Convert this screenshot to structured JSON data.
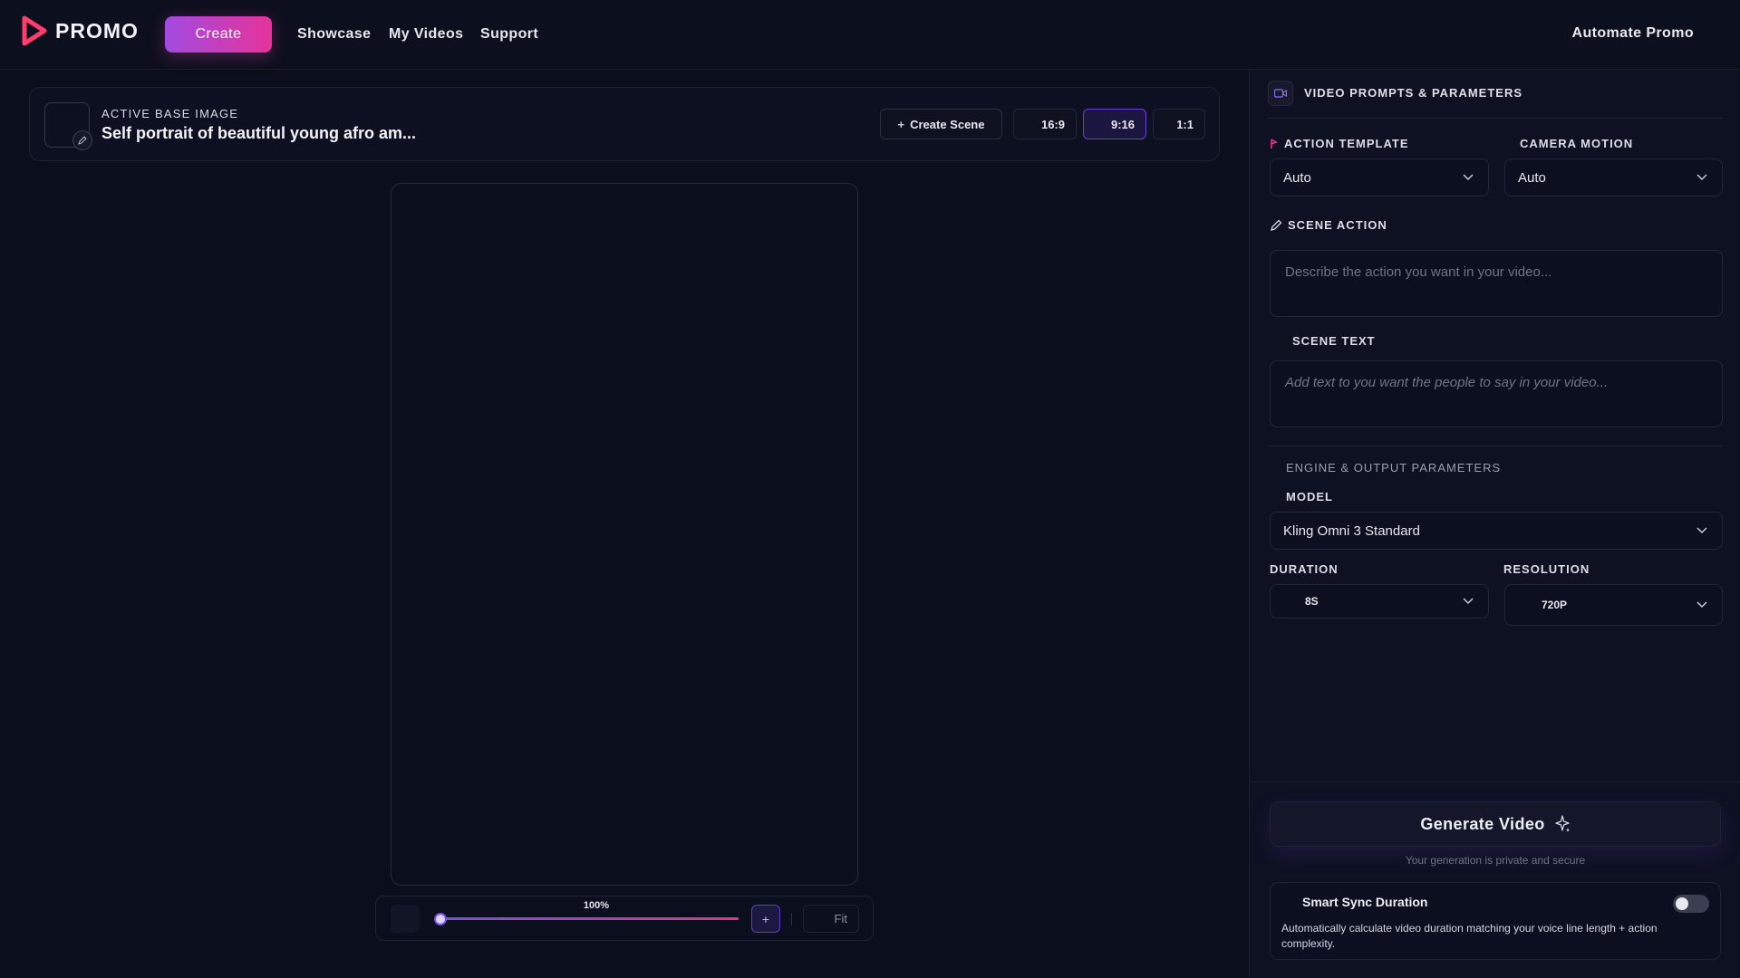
{
  "nav": {
    "logo_text": "PROMO",
    "create_label": "Create",
    "links": [
      "Showcase",
      "My Videos",
      "Support"
    ],
    "right_link": "Automate Promo"
  },
  "base_image": {
    "label": "ACTIVE BASE IMAGE",
    "title": "Self portrait of beautiful young afro am...",
    "create_scene_label": "Create Scene",
    "ratios": [
      "16:9",
      "9:16",
      "1:1"
    ],
    "active_ratio": "9:16"
  },
  "zoom": {
    "value": "100%",
    "plus_label": "+",
    "fit_label": "Fit"
  },
  "panel": {
    "header_title": "VIDEO PROMPTS & PARAMETERS",
    "action_template": {
      "label": "ACTION TEMPLATE",
      "value": "Auto"
    },
    "camera_motion": {
      "label": "CAMERA MOTION",
      "value": "Auto"
    },
    "scene_action": {
      "label": "SCENE ACTION",
      "placeholder": "Describe the action you want in your video..."
    },
    "scene_text": {
      "label": "SCENE TEXT",
      "placeholder": "Add text to you want the people to say in your video..."
    },
    "engine_title": "ENGINE & OUTPUT PARAMETERS",
    "model": {
      "label": "MODEL",
      "value": "Kling Omni 3 Standard"
    },
    "duration": {
      "label": "DURATION",
      "value": "8S"
    },
    "resolution": {
      "label": "RESOLUTION",
      "value": "720P"
    },
    "generate_label": "Generate Video",
    "private_note": "Your generation is private and secure",
    "smart_sync": {
      "title": "Smart Sync Duration",
      "description": "Automatically calculate video duration matching your voice line length + action complexity.",
      "enabled": false
    }
  },
  "colors": {
    "accent_purple": "#a24be0",
    "accent_pink": "#e6339a",
    "background": "#0b0e1c"
  }
}
